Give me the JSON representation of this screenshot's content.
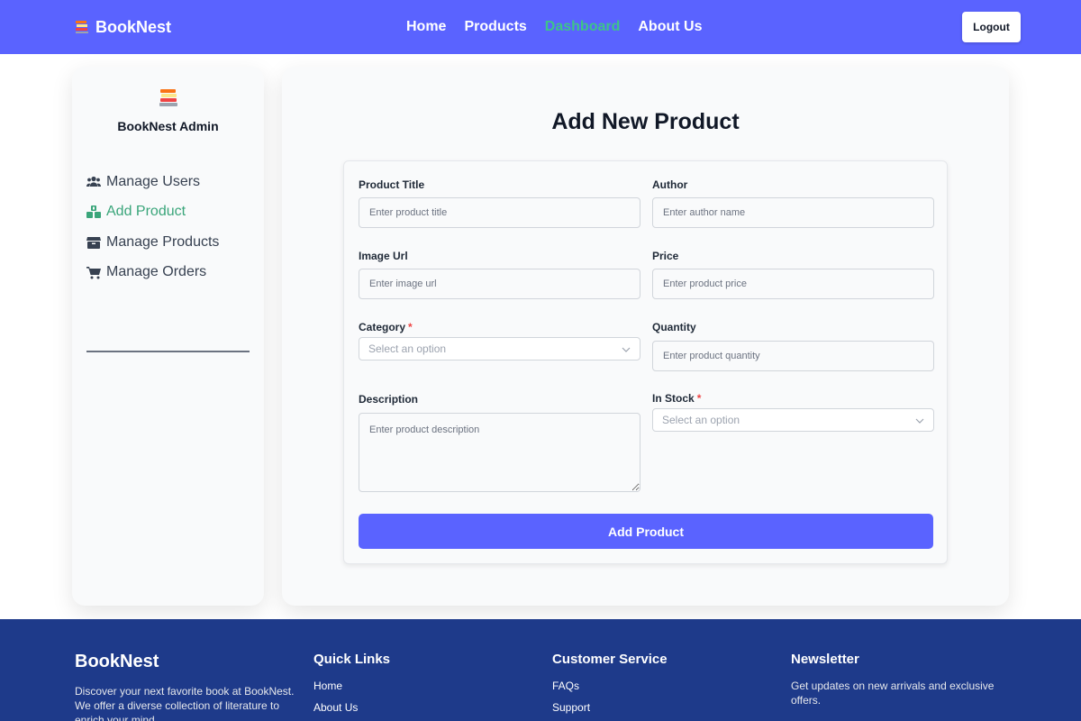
{
  "header": {
    "brand": "BookNest",
    "nav": [
      {
        "label": "Home"
      },
      {
        "label": "Products"
      },
      {
        "label": "Dashboard"
      },
      {
        "label": "About Us"
      }
    ],
    "logout_label": "Logout",
    "accent_color": "#5a63ff",
    "active_nav_color": "#3ec38a"
  },
  "sidebar": {
    "title": "BookNest Admin",
    "items": [
      {
        "label": "Manage Users",
        "icon": "users-icon"
      },
      {
        "label": "Add Product",
        "icon": "add-product-icon"
      },
      {
        "label": "Manage Products",
        "icon": "box-icon"
      },
      {
        "label": "Manage Orders",
        "icon": "cart-icon"
      }
    ]
  },
  "main": {
    "title": "Add New Product",
    "form": {
      "product_title": {
        "label": "Product Title",
        "placeholder": "Enter product title"
      },
      "author": {
        "label": "Author",
        "placeholder": "Enter author name"
      },
      "image_url": {
        "label": "Image Url",
        "placeholder": "Enter image url"
      },
      "price": {
        "label": "Price",
        "placeholder": "Enter product price"
      },
      "category": {
        "label": "Category",
        "required": "*",
        "placeholder": "Select an option"
      },
      "quantity": {
        "label": "Quantity",
        "placeholder": "Enter product quantity"
      },
      "description": {
        "label": "Description",
        "placeholder": "Enter product description"
      },
      "in_stock": {
        "label": "In Stock",
        "required": "*",
        "placeholder": "Select an option"
      },
      "submit_label": "Add Product"
    }
  },
  "footer": {
    "brand": "BookNest",
    "brand_text": "Discover your next favorite book at BookNest. We offer a diverse collection of literature to enrich your mind.",
    "quick_links": {
      "heading": "Quick Links",
      "items": [
        "Home",
        "About Us"
      ]
    },
    "customer_service": {
      "heading": "Customer Service",
      "items": [
        "FAQs",
        "Support"
      ]
    },
    "newsletter": {
      "heading": "Newsletter",
      "text": "Get updates on new arrivals and exclusive offers."
    },
    "background_color": "#1e3a8a"
  }
}
